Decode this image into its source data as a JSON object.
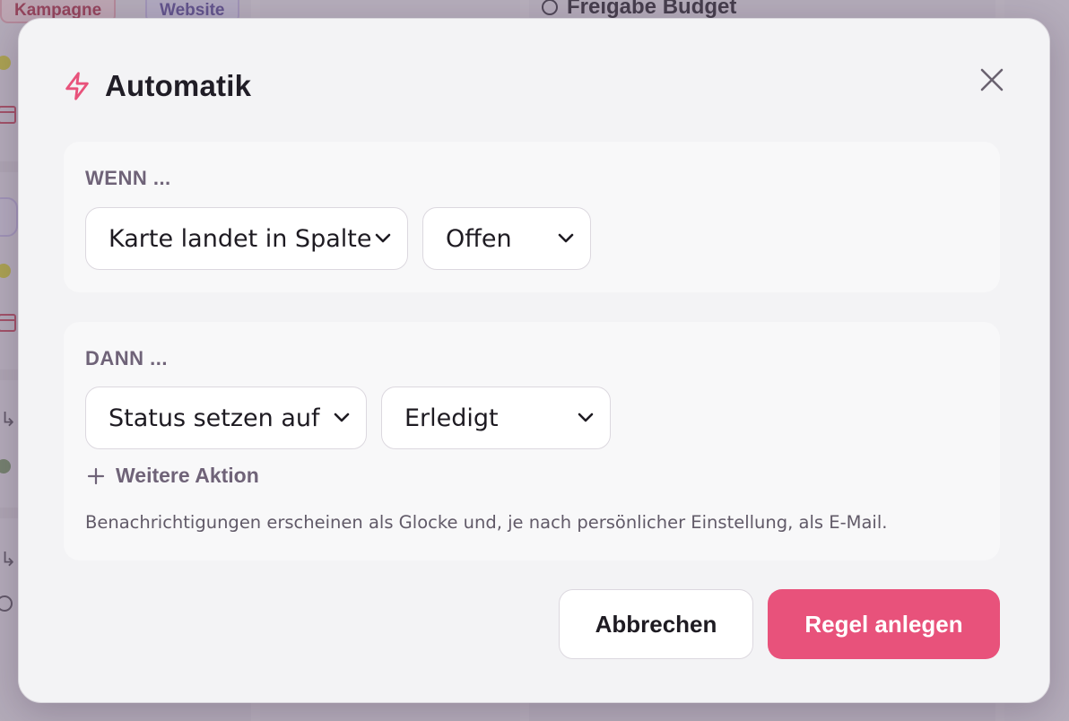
{
  "background": {
    "tags": [
      "Kampagne",
      "Website"
    ],
    "task_title": "Freigabe Budget"
  },
  "modal": {
    "title": "Automatik",
    "icon": "lightning-bolt-icon",
    "accent_color": "#e8527b",
    "when": {
      "label": "WENN ...",
      "trigger_select": {
        "value": "Karte landet in Spalte"
      },
      "column_select": {
        "value": "Offen"
      }
    },
    "then": {
      "label": "DANN ...",
      "action_select": {
        "value": "Status setzen auf"
      },
      "status_select": {
        "value": "Erledigt"
      },
      "add_action_label": "Weitere Aktion",
      "hint": "Benachrichtigungen erscheinen als Glocke und, je nach persönlicher Einstellung, als E-Mail."
    },
    "buttons": {
      "cancel": "Abbrechen",
      "create": "Regel anlegen"
    }
  }
}
